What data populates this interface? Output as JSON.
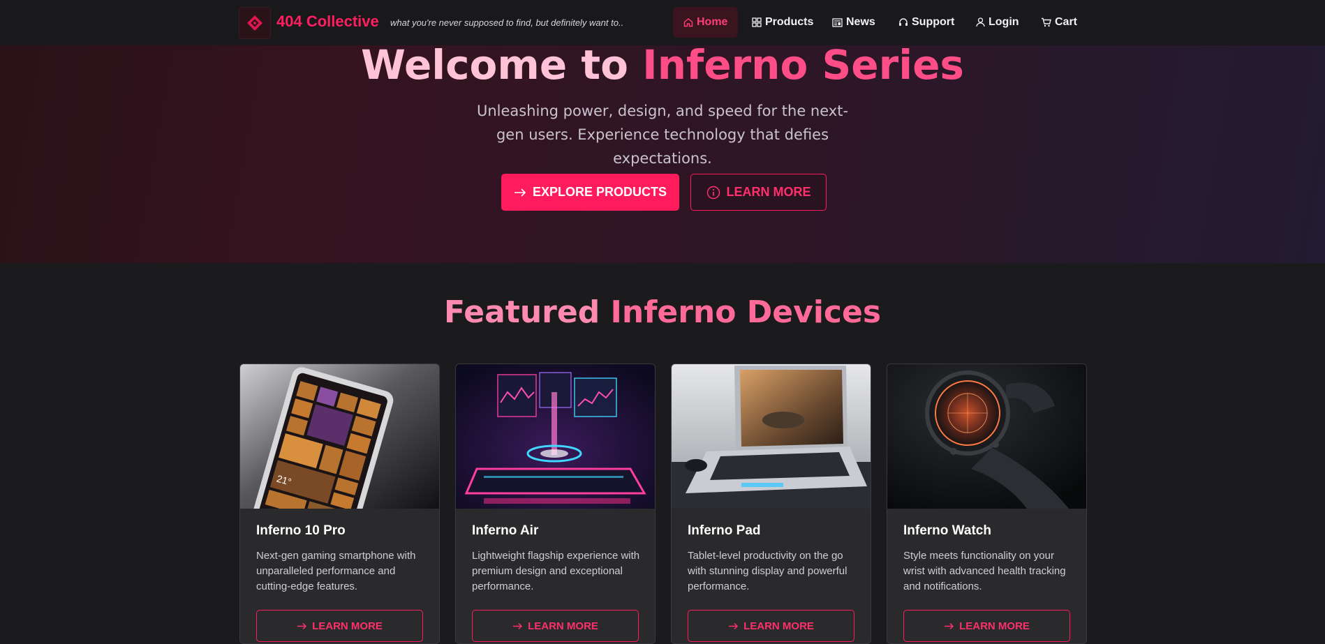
{
  "nav": {
    "brand_name": "404 Collective",
    "tagline": "what you're never supposed to find, but definitely want to..",
    "items": [
      {
        "label": "Home",
        "icon": "home-icon",
        "active": true
      },
      {
        "label": "Products",
        "icon": "grid-icon"
      },
      {
        "label": "News",
        "icon": "newspaper-icon"
      },
      {
        "label": "Support",
        "icon": "headset-icon"
      },
      {
        "label": "Login",
        "icon": "user-icon"
      },
      {
        "label": "Cart",
        "icon": "cart-icon"
      }
    ]
  },
  "hero": {
    "title_part1": "Welcome to ",
    "title_part2": "Inferno Series",
    "subtitle": "Unleashing power, design, and speed for the next-gen users. Experience technology that defies expectations.",
    "primary_button": "EXPLORE PRODUCTS",
    "secondary_button": "LEARN MORE"
  },
  "featured": {
    "title_part1": "Featured ",
    "title_part2": "Inferno Devices",
    "cards": [
      {
        "title": "Inferno 10 Pro",
        "description": "Next-gen gaming smartphone with unparalleled performance and cutting-edge features.",
        "button": "LEARN MORE",
        "image": "smartphone-image"
      },
      {
        "title": "Inferno Air",
        "description": "Lightweight flagship experience with premium design and exceptional performance.",
        "button": "LEARN MORE",
        "image": "holographic-phone-image"
      },
      {
        "title": "Inferno Pad",
        "description": "Tablet-level productivity on the go with stunning display and powerful performance.",
        "button": "LEARN MORE",
        "image": "laptop-image"
      },
      {
        "title": "Inferno Watch",
        "description": "Style meets functionality on your wrist with advanced health tracking and notifications.",
        "button": "LEARN MORE",
        "image": "smartwatch-image"
      }
    ]
  },
  "colors": {
    "accent": "#ff1b5c",
    "background": "#1b1b1d",
    "card": "#2a2a2d"
  }
}
